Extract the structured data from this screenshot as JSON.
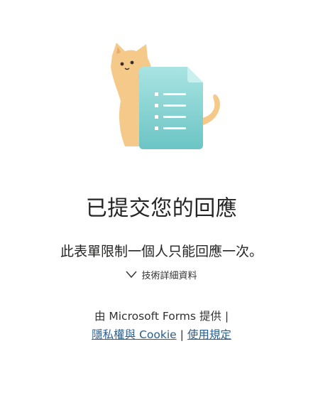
{
  "confirmation": {
    "title": "已提交您的回應",
    "limit_message": "此表單限制一個人只能回應一次。",
    "details_label": "技術詳細資料"
  },
  "footer": {
    "powered_by": "由 Microsoft Forms 提供 |",
    "privacy_link": "隱私權與 Cookie",
    "separator": "|",
    "terms_link": "使用規定"
  },
  "icons": {
    "illustration": "cat-with-form-illustration",
    "toggle": "chevron-down-icon"
  },
  "colors": {
    "link": "#2b5e8c",
    "cat": "#f4c98a",
    "document": "#7fd3d3"
  }
}
